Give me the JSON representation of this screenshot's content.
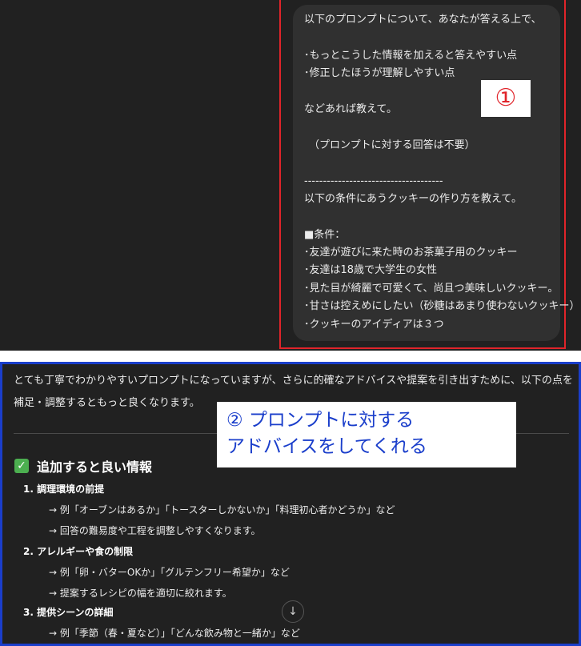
{
  "prompt": {
    "lines": [
      "以下のプロンプトについて、あなたが答える上で、",
      "",
      "･もっとこうした情報を加えると答えやすい点",
      "･修正したほうが理解しやすい点",
      "",
      "などあれば教えて。",
      "",
      "（プロンプトに対する回答は不要）",
      "",
      "-------------------------------------",
      "以下の条件にあうクッキーの作り方を教えて。",
      "",
      "■条件：",
      "･友達が遊びに来た時のお茶菓子用のクッキー",
      "･友達は18歳で大学生の女性",
      "･見た目が綺麗で可愛くて、尚且つ美味しいクッキー。",
      "･甘さは控えめにしたい（砂糖はあまり使わないクッキー）",
      "･クッキーのアイディアは３つ"
    ]
  },
  "annotation1": "①",
  "annotation2": [
    "② プロンプトに対する",
    "アドバイスをしてくれる"
  ],
  "response": {
    "intro": "とても丁寧でわかりやすいプロンプトになっていますが、さらに的確なアドバイスや提案を引き出すために、以下の点を補足・調整するともっと良くなります。",
    "section_title": "追加すると良い情報",
    "items": [
      {
        "head": "1.  調理環境の前提",
        "subs": [
          "→ 例「オーブンはあるか」「トースターしかないか」「料理初心者かどうか」など",
          "→ 回答の難易度や工程を調整しやすくなります。"
        ]
      },
      {
        "head": "2.  アレルギーや食の制限",
        "subs": [
          "→ 例「卵・バターOKか」「グルテンフリー希望か」など",
          "→ 提案するレシピの幅を適切に絞れます。"
        ]
      },
      {
        "head": "3.  提供シーンの詳細",
        "subs": [
          "→ 例「季節（春・夏など）」「どんな飲み物と一緒か」など"
        ]
      }
    ]
  },
  "colors": {
    "red_annotation": "#e0242a",
    "blue_annotation": "#1a3ecb",
    "check": "#4caf50"
  }
}
